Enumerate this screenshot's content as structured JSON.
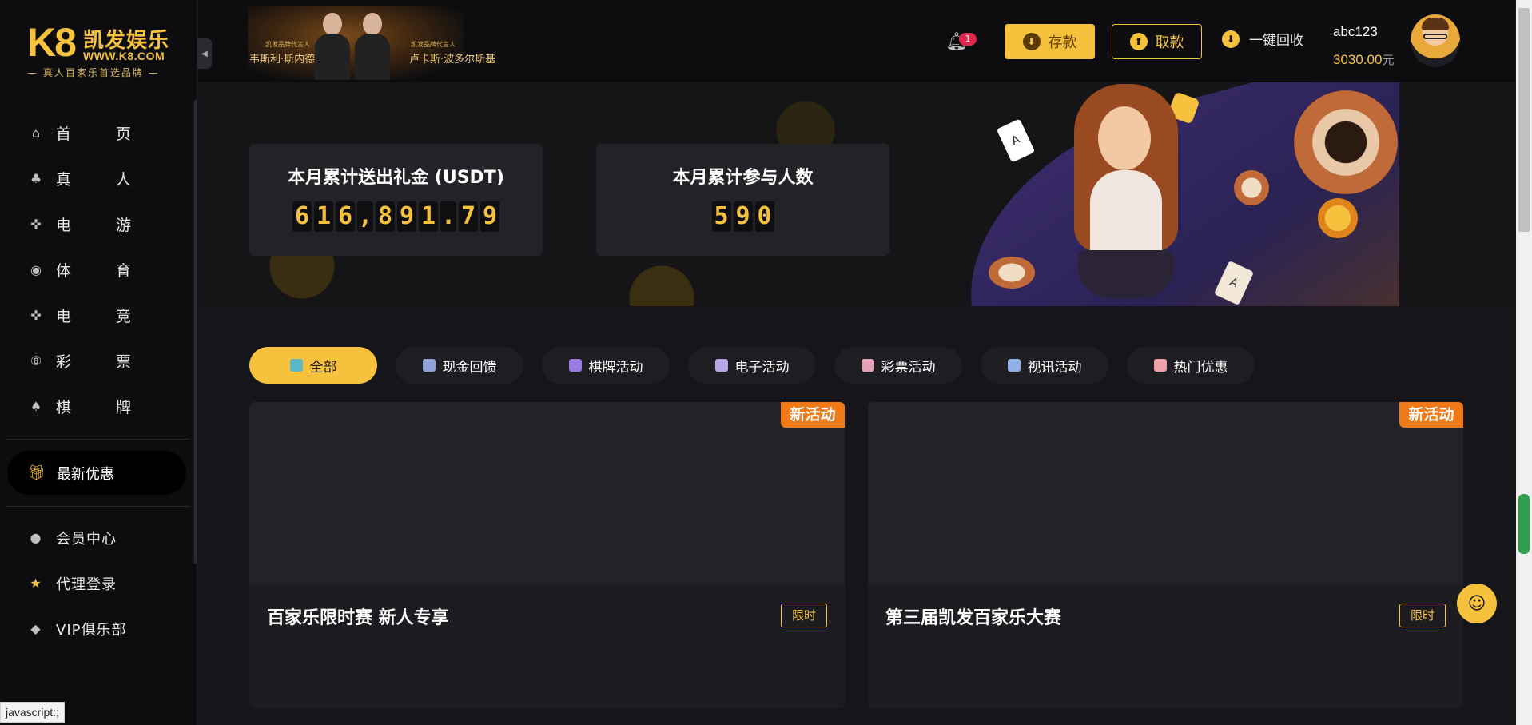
{
  "brand": {
    "logo_mark": "K8",
    "name": "凯发娱乐",
    "url": "WWW.K8.COM",
    "tagline": "— 真人百家乐首选品牌 —"
  },
  "sidebar": {
    "items": [
      {
        "label": "首页",
        "icon": "home-icon"
      },
      {
        "label": "真人",
        "icon": "live-dealer-icon"
      },
      {
        "label": "电游",
        "icon": "gamepad-icon"
      },
      {
        "label": "体育",
        "icon": "soccer-ball-icon"
      },
      {
        "label": "电竞",
        "icon": "esports-icon"
      },
      {
        "label": "彩票",
        "icon": "lottery-icon"
      },
      {
        "label": "棋牌",
        "icon": "cards-icon"
      }
    ],
    "promo": {
      "label": "最新优惠",
      "icon": "gift-icon"
    },
    "bottom": [
      {
        "label": "会员中心",
        "icon": "user-icon"
      },
      {
        "label": "代理登录",
        "icon": "star-icon"
      },
      {
        "label": "VIP俱乐部",
        "icon": "diamond-icon"
      }
    ]
  },
  "header": {
    "ambassadors": [
      {
        "caption": "凯发品牌代言人",
        "name": "韦斯利·斯内德"
      },
      {
        "caption": "凯发品牌代言人",
        "name": "卢卡斯·波多尔斯基"
      }
    ],
    "notification_count": "1",
    "deposit_label": "存款",
    "withdraw_label": "取款",
    "recycle_label": "一键回收",
    "username": "abc123",
    "balance": "3030.00",
    "balance_unit": "元"
  },
  "stats": {
    "gift_title": "本月累计送出礼金 (USDT)",
    "gift_value": "616,891.79",
    "participants_title": "本月累计参与人数",
    "participants_value": "590"
  },
  "tabs": [
    {
      "label": "全部",
      "active": true,
      "icon_color": "#5bb8c9"
    },
    {
      "label": "现金回馈",
      "active": false,
      "icon_color": "#8fa3d8"
    },
    {
      "label": "棋牌活动",
      "active": false,
      "icon_color": "#9a7be0"
    },
    {
      "label": "电子活动",
      "active": false,
      "icon_color": "#b7a6e6"
    },
    {
      "label": "彩票活动",
      "active": false,
      "icon_color": "#e4a2b8"
    },
    {
      "label": "视讯活动",
      "active": false,
      "icon_color": "#8fb0e6"
    },
    {
      "label": "热门优惠",
      "active": false,
      "icon_color": "#f0a0a8"
    }
  ],
  "promotions": [
    {
      "tag": "新活动",
      "title": "百家乐限时赛 新人专享",
      "badge": "限时"
    },
    {
      "tag": "新活动",
      "title": "第三届凯发百家乐大赛",
      "badge": "限时"
    }
  ],
  "status_bar": "javascript:;",
  "colors": {
    "accent": "#f6c23e",
    "tag": "#f07a18",
    "background": "#151518"
  }
}
